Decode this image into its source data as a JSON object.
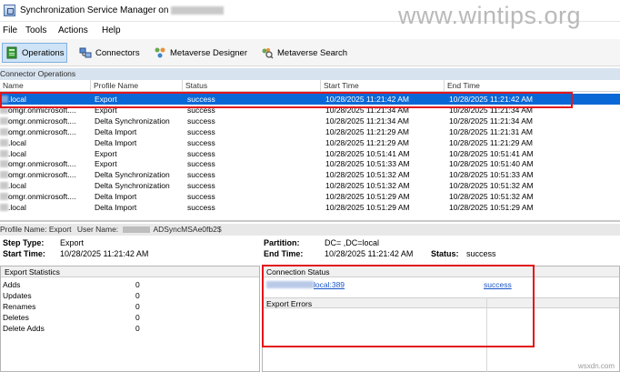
{
  "window": {
    "title": "Synchronization Service Manager on",
    "watermark": "www.wintips.org"
  },
  "menu": [
    "File",
    "Tools",
    "Actions",
    "Help"
  ],
  "toolbar": {
    "operations": "Operations",
    "connectors": "Connectors",
    "metaverse_designer": "Metaverse Designer",
    "metaverse_search": "Metaverse Search"
  },
  "connector_ops": {
    "header": "Connector Operations",
    "columns": [
      "Name",
      "Profile Name",
      "Status",
      "Start Time",
      "End Time"
    ],
    "rows": [
      {
        "name": ".local",
        "profile": "Export",
        "status": "success",
        "start": "10/28/2025 11:21:42 AM",
        "end": "10/28/2025 11:21:42 AM"
      },
      {
        "name": "omgr.onmicrosoft....",
        "profile": "Export",
        "status": "success",
        "start": "10/28/2025 11:21:34 AM",
        "end": "10/28/2025 11:21:34 AM"
      },
      {
        "name": "omgr.onmicrosoft....",
        "profile": "Delta Synchronization",
        "status": "success",
        "start": "10/28/2025 11:21:34 AM",
        "end": "10/28/2025 11:21:34 AM"
      },
      {
        "name": "omgr.onmicrosoft....",
        "profile": "Delta Import",
        "status": "success",
        "start": "10/28/2025 11:21:29 AM",
        "end": "10/28/2025 11:21:31 AM"
      },
      {
        "name": ".local",
        "profile": "Delta Import",
        "status": "success",
        "start": "10/28/2025 11:21:29 AM",
        "end": "10/28/2025 11:21:29 AM"
      },
      {
        "name": ".local",
        "profile": "Export",
        "status": "success",
        "start": "10/28/2025 10:51:41 AM",
        "end": "10/28/2025 10:51:41 AM"
      },
      {
        "name": "omgr.onmicrosoft....",
        "profile": "Export",
        "status": "success",
        "start": "10/28/2025 10:51:33 AM",
        "end": "10/28/2025 10:51:40 AM"
      },
      {
        "name": "omgr.onmicrosoft....",
        "profile": "Delta Synchronization",
        "status": "success",
        "start": "10/28/2025 10:51:32 AM",
        "end": "10/28/2025 10:51:33 AM"
      },
      {
        "name": ".local",
        "profile": "Delta Synchronization",
        "status": "success",
        "start": "10/28/2025 10:51:32 AM",
        "end": "10/28/2025 10:51:32 AM"
      },
      {
        "name": "omgr.onmicrosoft....",
        "profile": "Delta Import",
        "status": "success",
        "start": "10/28/2025 10:51:29 AM",
        "end": "10/28/2025 10:51:32 AM"
      },
      {
        "name": ".local",
        "profile": "Delta Import",
        "status": "success",
        "start": "10/28/2025 10:51:29 AM",
        "end": "10/28/2025 10:51:29 AM"
      }
    ]
  },
  "profile_bar": {
    "profile_label": "Profile Name:",
    "profile_value": "Export",
    "user_label": "User Name:",
    "user_value": "ADSyncMSAe0fb2$"
  },
  "details": {
    "step_type_label": "Step Type:",
    "step_type_value": "Export",
    "start_time_label": "Start Time:",
    "start_time_value": "10/28/2025 11:21:42 AM",
    "partition_label": "Partition:",
    "partition_value": "DC=    ,DC=local",
    "end_time_label": "End Time:",
    "end_time_value": "10/28/2025 11:21:42 AM",
    "status_label": "Status:",
    "status_value": "success"
  },
  "export_stats": {
    "title": "Export Statistics",
    "rows": [
      {
        "label": "Adds",
        "value": "0"
      },
      {
        "label": "Updates",
        "value": "0"
      },
      {
        "label": "Renames",
        "value": "0"
      },
      {
        "label": "Deletes",
        "value": "0"
      },
      {
        "label": "Delete Adds",
        "value": "0"
      }
    ]
  },
  "connection_status": {
    "title": "Connection Status",
    "server": "local:389",
    "result": "success",
    "errors_title": "Export Errors"
  },
  "footer": {
    "watermark": "wsxdn.com"
  },
  "colors": {
    "selection": "#0a68d6",
    "highlight_box": "#e3151b",
    "section_header": "#d8e3f0",
    "link": "#1a56c9"
  }
}
